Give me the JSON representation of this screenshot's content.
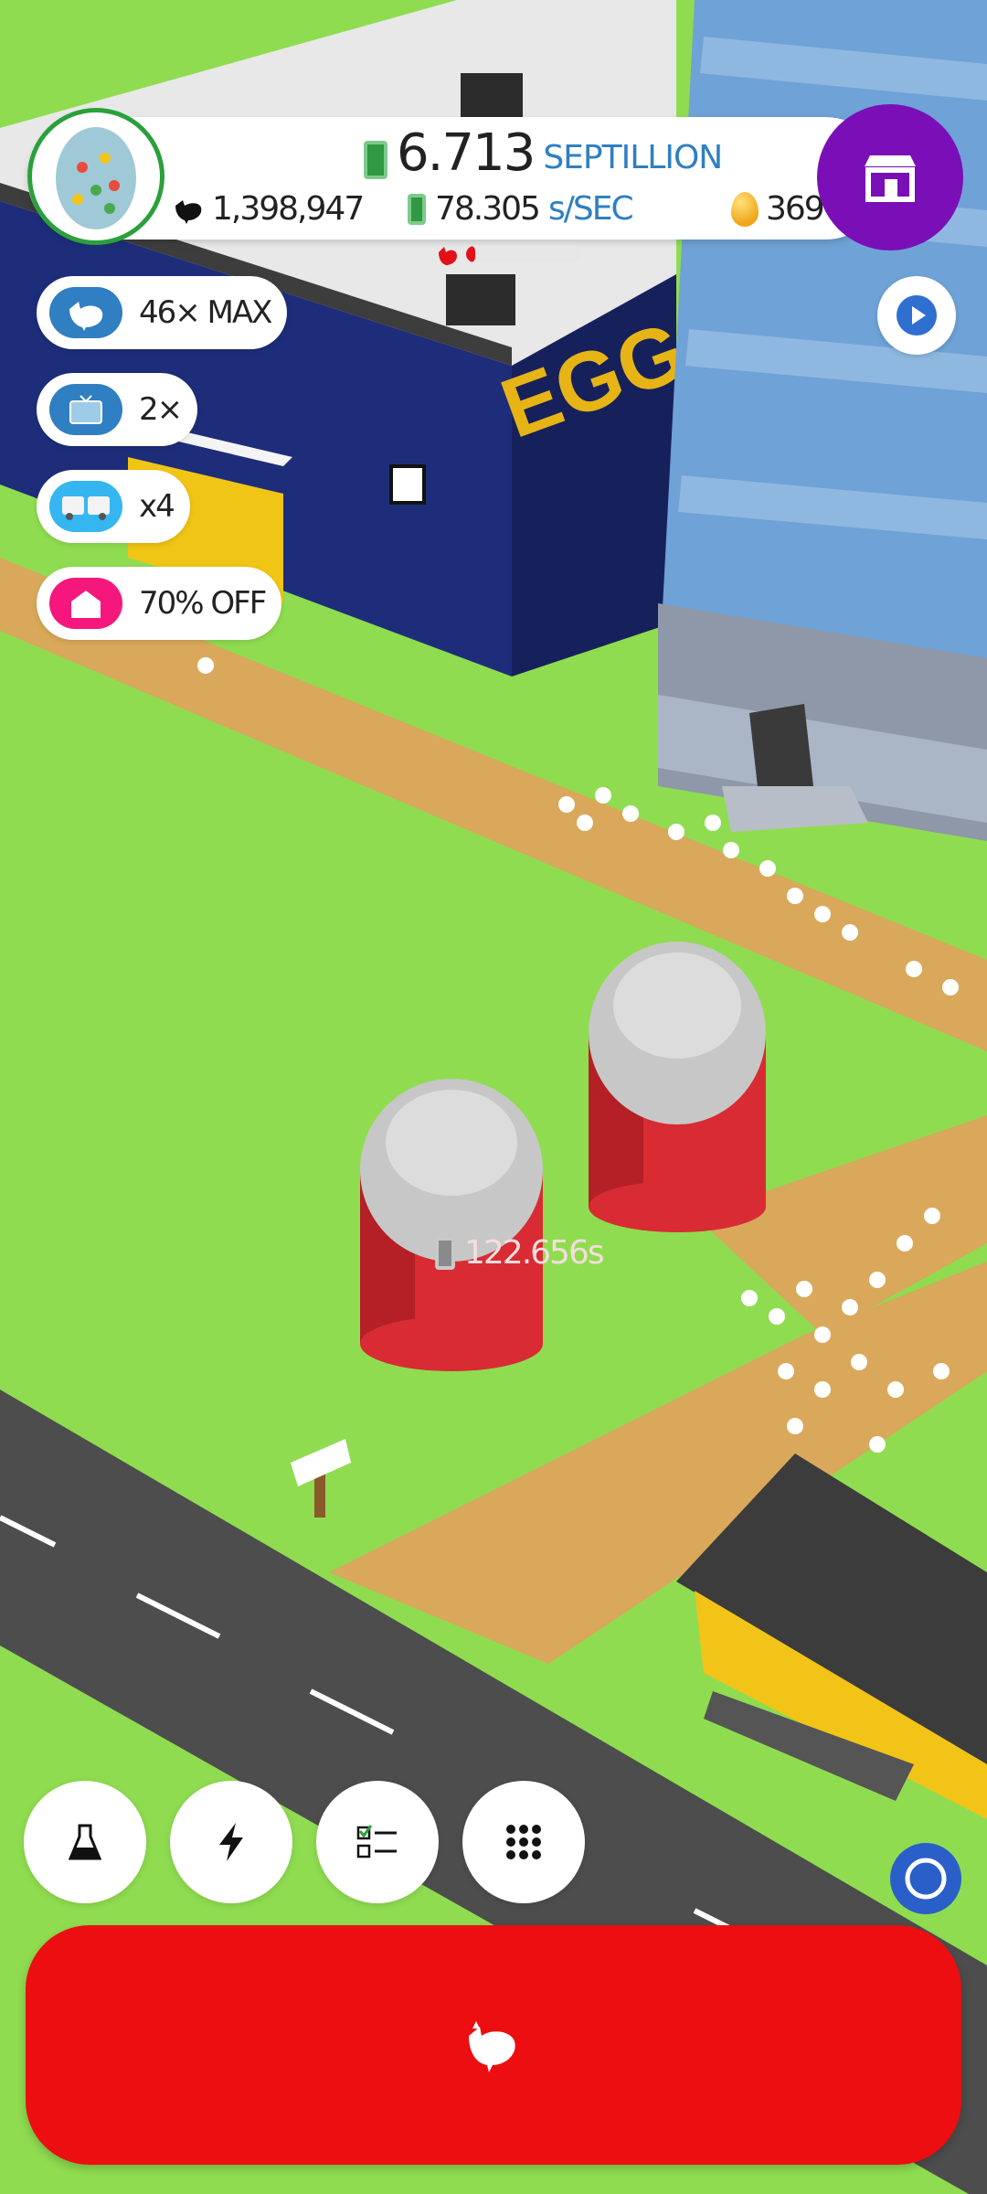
{
  "header": {
    "money_value": "6.713",
    "money_unit": "SEPTILLION",
    "chicken_count": "1,398,947",
    "rate_value": "78.305",
    "rate_unit": "s/SEC",
    "golden_eggs": "369",
    "hatchery_fraction": 0.08
  },
  "boosts": [
    {
      "label": "46× MAX",
      "color": "#2f7fc2"
    },
    {
      "label": "2×",
      "color": "#2f7fc2"
    },
    {
      "label": "x4",
      "color": "#35b6f0"
    },
    {
      "label": "70% OFF",
      "color": "#f5177c"
    }
  ],
  "silo_label": "122.656s",
  "scene_sign": "EGGI",
  "toolbar": {
    "research_icon": "flask-icon",
    "boost_icon": "lightning-icon",
    "missions_icon": "checklist-icon",
    "menu_icon": "grid-icon"
  },
  "colors": {
    "grass": "#8fdc50",
    "hatch_button": "#ec0e10",
    "shop_button": "#7a0fb8",
    "money_unit": "#2f7fc2"
  }
}
